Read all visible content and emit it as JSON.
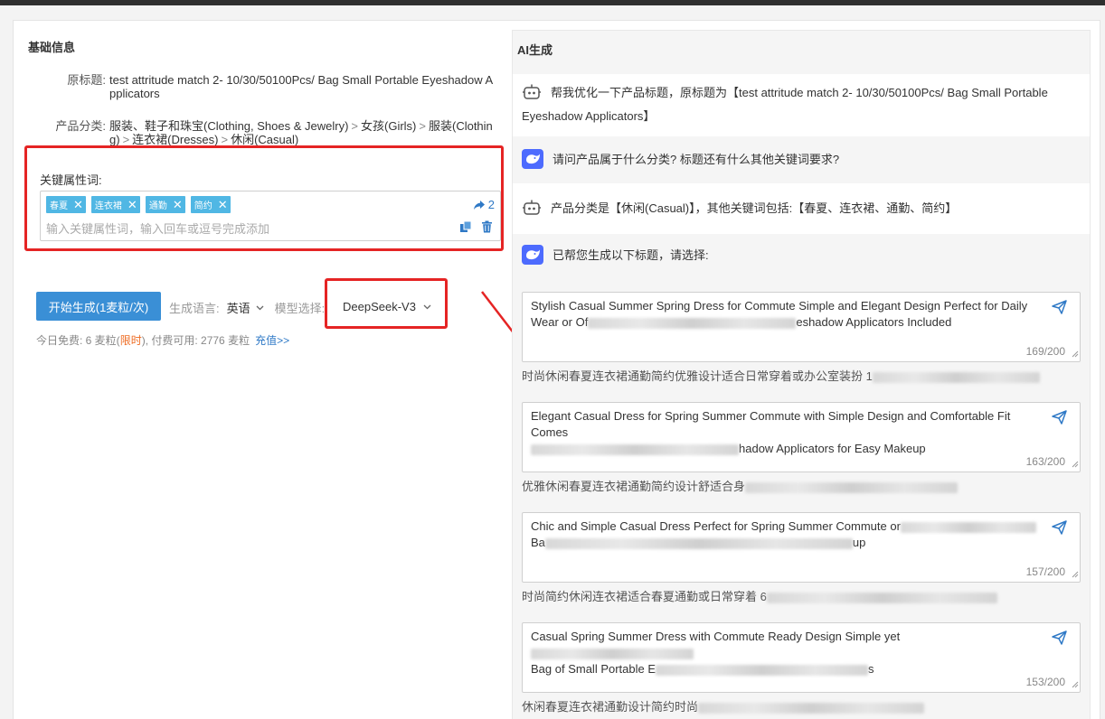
{
  "basic": {
    "title": "基础信息",
    "orig_title_label": "原标题:",
    "orig_title_value": "test attritude match 2- 10/30/50100Pcs/ Bag Small Portable Eyeshadow Applicators",
    "category_label": "产品分类:",
    "category_path": [
      "服装、鞋子和珠宝(Clothing, Shoes & Jewelry)",
      "女孩(Girls)",
      "服装(Clothing)",
      "连衣裙(Dresses)",
      "休闲(Casual)"
    ],
    "category_sep": ">"
  },
  "keywords": {
    "label": "关键属性词:",
    "tags": [
      "春夏",
      "连衣裙",
      "通勤",
      "简约"
    ],
    "count": "2",
    "placeholder": "输入关键属性词，输入回车或逗号完成添加"
  },
  "controls": {
    "generate_button": "开始生成(1麦粒/次)",
    "language_label": "生成语言:",
    "language_value": "英语",
    "model_label": "模型选择:",
    "model_value": "DeepSeek-V3",
    "quota_prefix": "今日免费: 6 麦粒(",
    "quota_limited": "限时",
    "quota_suffix": "), 付费可用: 2776 麦粒",
    "recharge_link": "充值>>"
  },
  "ai": {
    "title": "AI生成",
    "messages": [
      {
        "role": "user",
        "text": "帮我优化一下产品标题，原标题为【test attritude match 2- 10/30/50100Pcs/ Bag Small Portable Eyeshadow Applicators】"
      },
      {
        "role": "bot",
        "text": "请问产品属于什么分类? 标题还有什么其他关键词要求?"
      },
      {
        "role": "user",
        "text": "产品分类是【休闲(Casual)】，其他关键词包括:【春夏、连衣裙、通勤、简约】"
      },
      {
        "role": "bot",
        "text": "已帮您生成以下标题，请选择:"
      }
    ],
    "results": [
      {
        "line1": "Stylish Casual Summer Spring Dress for Commute Simple and Elegant Design Perfect for Daily",
        "line2_start": "Wear or Of",
        "line2_end": "eshadow Applicators Included",
        "count": "169/200",
        "cn_start": "时尚休闲春夏连衣裙通勤简约优雅设计适合日常穿着或办公室装扮 1"
      },
      {
        "line1": "Elegant Casual Dress for Spring Summer Commute with Simple Design and Comfortable Fit Comes",
        "line2_start": "",
        "line2_end": "hadow Applicators for Easy Makeup",
        "count": "163/200",
        "cn_start": "优雅休闲春夏连衣裙通勤简约设计舒适合身"
      },
      {
        "line1": "Chic and Simple Casual Dress Perfect for Spring Summer Commute or",
        "line2_start": "Ba",
        "line2_end": "up",
        "count": "157/200",
        "cn_start": "时尚简约休闲连衣裙适合春夏通勤或日常穿着 6"
      },
      {
        "line1": "Casual Spring Summer Dress with Commute Ready Design Simple yet",
        "line2_start": "Bag of Small Portable E",
        "line2_end": "s",
        "count": "153/200",
        "cn_start": "休闲春夏连衣裙通勤设计简约时尚"
      }
    ]
  },
  "colors": {
    "primary": "#3a8fd6",
    "tag": "#50b7e4",
    "highlight": "#e52424",
    "link": "#2f79c6",
    "limited": "#ee6a20"
  }
}
